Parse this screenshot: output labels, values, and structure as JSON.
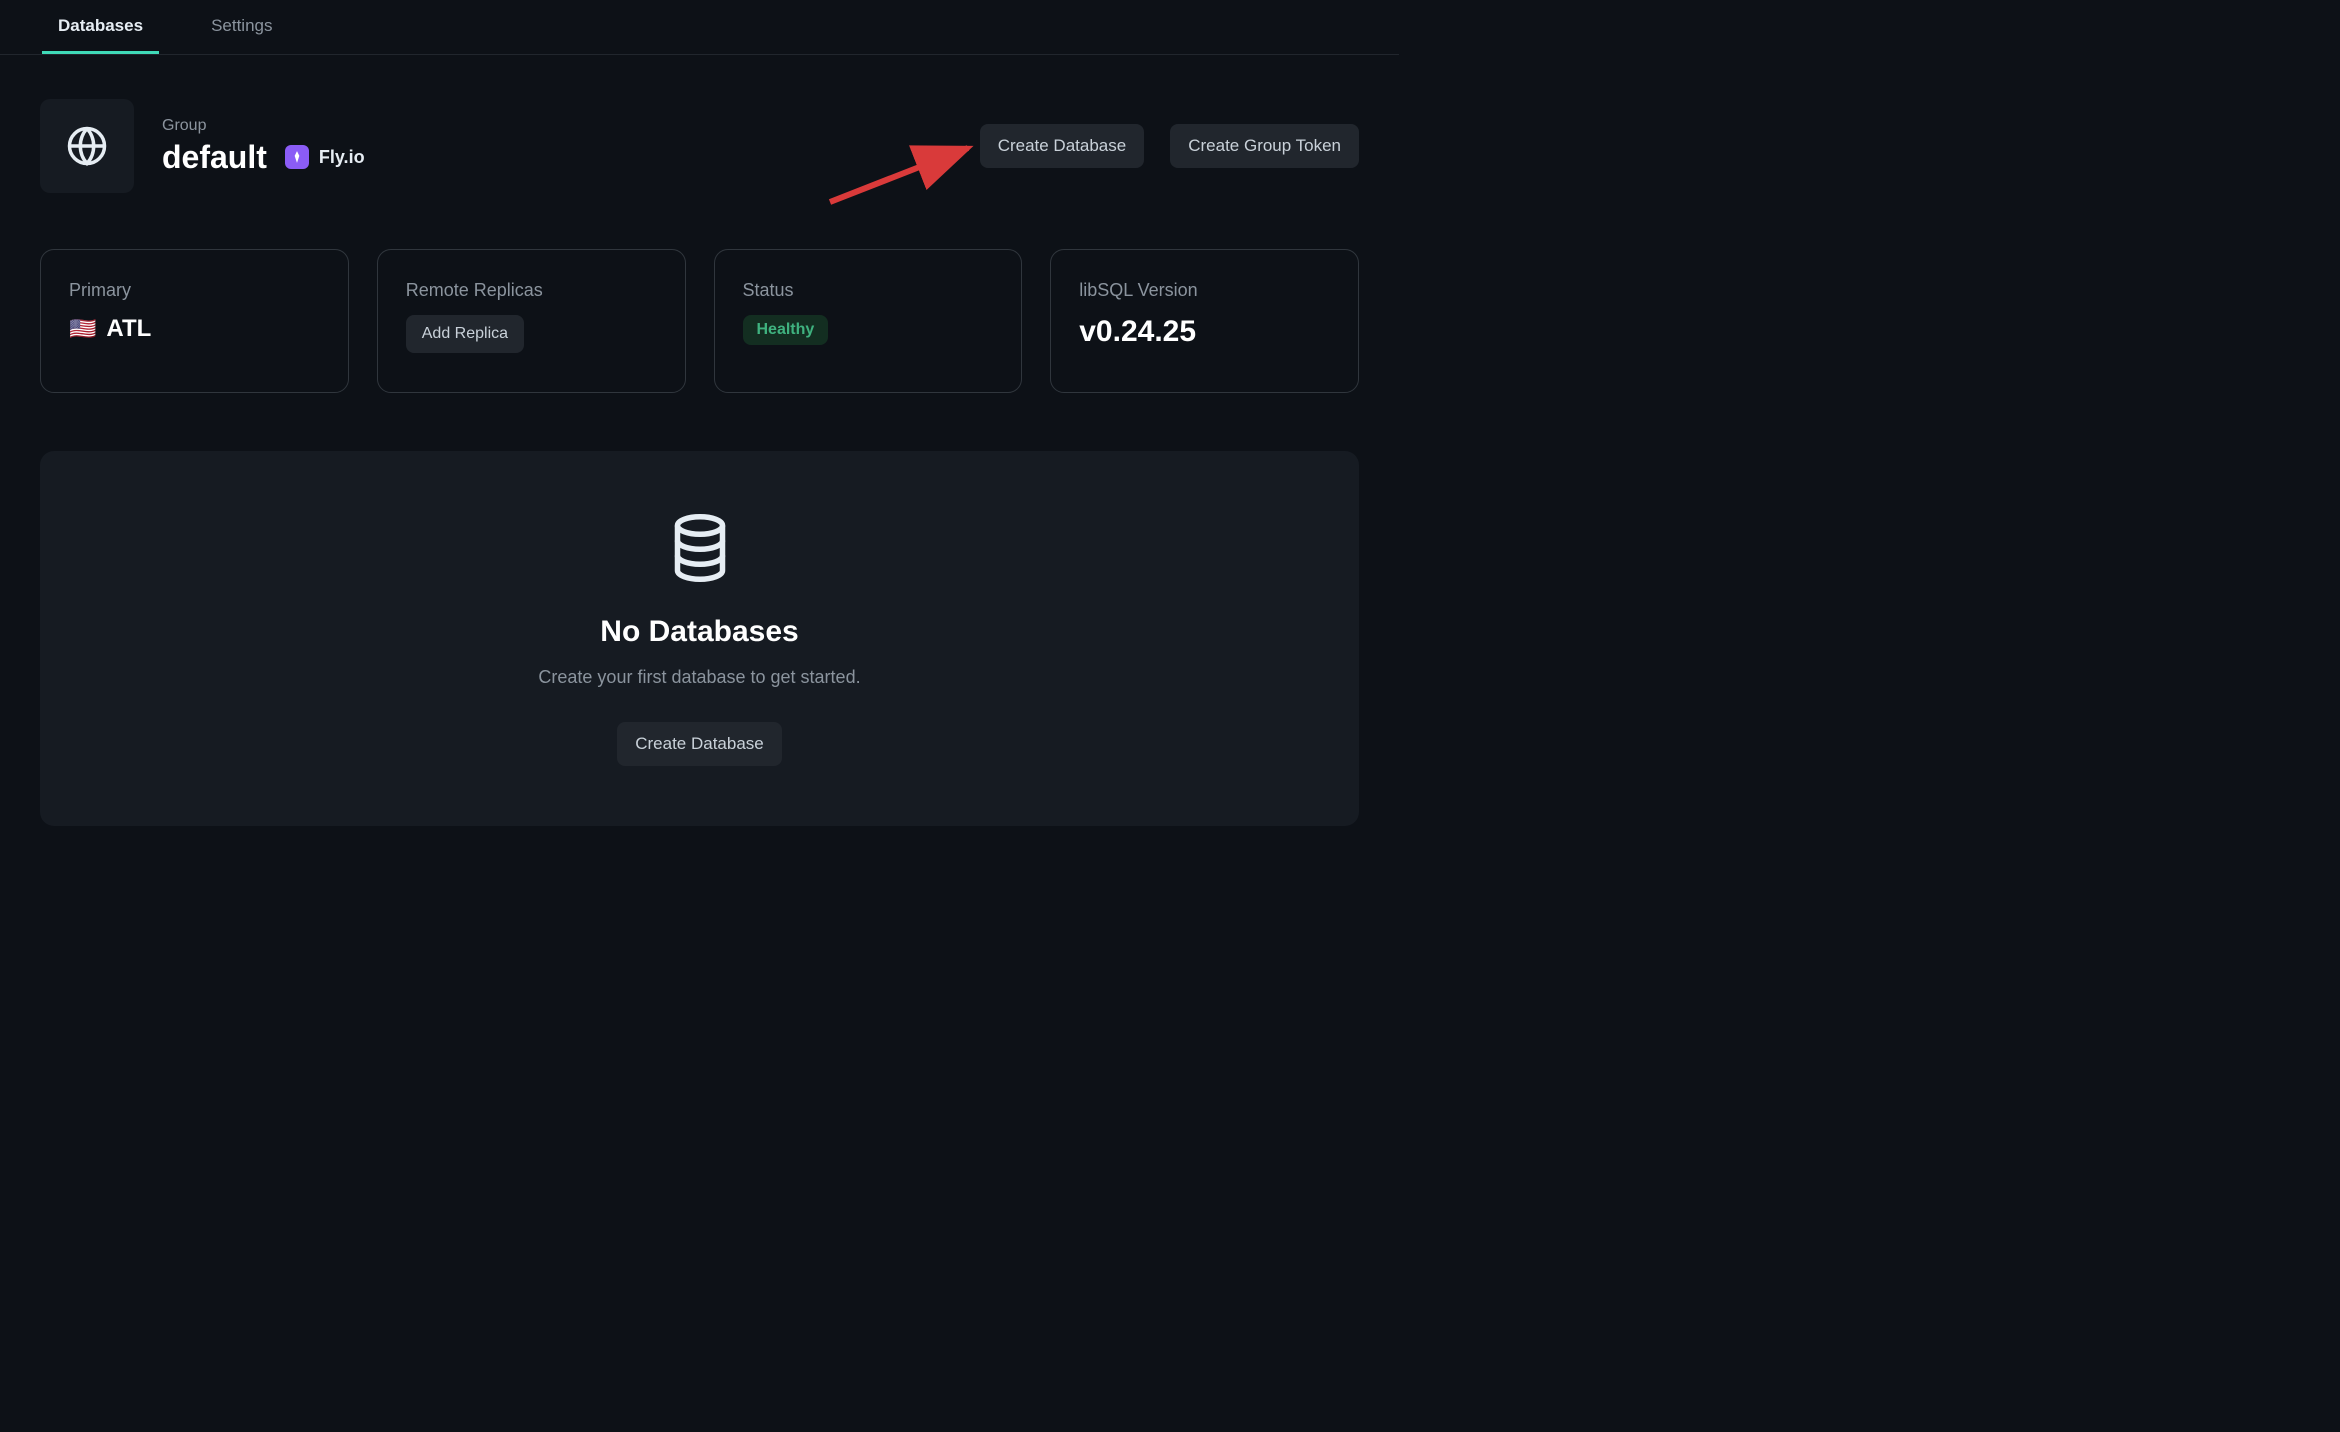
{
  "tabs": {
    "databases": "Databases",
    "settings": "Settings"
  },
  "header": {
    "group_label": "Group",
    "group_name": "default",
    "provider": "Fly.io"
  },
  "actions": {
    "create_database": "Create Database",
    "create_group_token": "Create Group Token"
  },
  "cards": {
    "primary": {
      "label": "Primary",
      "flag": "🇺🇸",
      "code": "ATL"
    },
    "replicas": {
      "label": "Remote Replicas",
      "add_button": "Add Replica"
    },
    "status": {
      "label": "Status",
      "value": "Healthy"
    },
    "version": {
      "label": "libSQL Version",
      "value": "v0.24.25"
    }
  },
  "empty": {
    "heading": "No Databases",
    "subtext": "Create your first database to get started.",
    "button": "Create Database"
  }
}
